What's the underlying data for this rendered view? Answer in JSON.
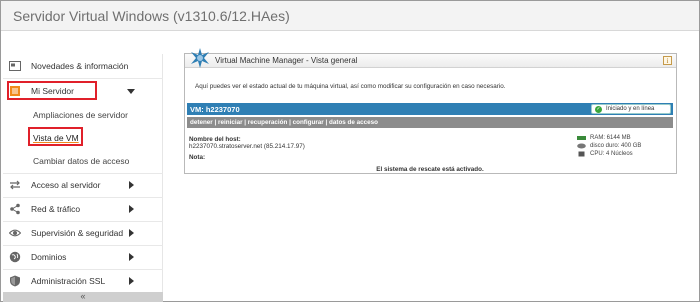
{
  "window": {
    "title": "Servidor Virtual Windows (v1310.6/12.HAes)"
  },
  "sidebar": {
    "items": [
      {
        "label": "Novedades & información",
        "icon": "news-icon"
      },
      {
        "label": "Mi Servidor",
        "icon": "server-icon",
        "expanded": true
      },
      {
        "label": "Acceso al servidor",
        "icon": "arrows-icon"
      },
      {
        "label": "Red & tráfico",
        "icon": "share-icon"
      },
      {
        "label": "Supervisión & seguridad",
        "icon": "eye-icon"
      },
      {
        "label": "Dominios",
        "icon": "globe-icon"
      },
      {
        "label": "Administración SSL",
        "icon": "shield-icon"
      }
    ],
    "subitems": [
      {
        "label": "Ampliaciones de servidor"
      },
      {
        "label": "Vista de VM",
        "active": true
      },
      {
        "label": "Cambiar datos de acceso"
      }
    ],
    "collapse_label": "«"
  },
  "panel": {
    "title": "Virtual Machine Manager - Vista general",
    "info_label": "i",
    "description": "Aquí puedes ver el estado actual de tu máquina virtual, así como modificar su configuración en caso necesario.",
    "vm_name": "VM: h2237070",
    "status": "Iniciado y en línea",
    "actions": [
      "detener",
      "reiniciar",
      "recuperación",
      "configurar",
      "datos de acceso"
    ],
    "action_separator": " | ",
    "host_label": "Nombre del host:",
    "host_value": "h2237070.stratoserver.net (85.214.17.97)",
    "note_label": "Nota:",
    "specs": {
      "ram": "RAM: 6144 MB",
      "disk": "disco duro: 400 GB",
      "cpu": "CPU: 4 Núcleos"
    },
    "rescue_message": "El sistema de rescate está activado."
  },
  "colors": {
    "highlight": "#e0202a",
    "vm_bar": "#2f7fb4",
    "action_bar": "#8c8c8c",
    "status_ok": "#3aa53a"
  }
}
